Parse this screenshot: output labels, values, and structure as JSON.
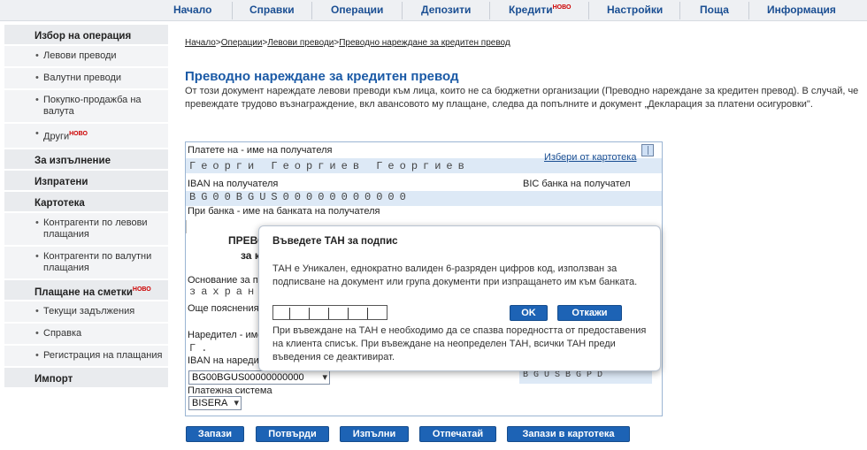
{
  "topnav": {
    "items": [
      "Начало",
      "Справки",
      "Операции",
      "Депозити",
      "Кредити",
      "Настройки",
      "Поща",
      "Информация"
    ],
    "new_badge": "НОВО"
  },
  "sidebar": {
    "sections": [
      {
        "title": "Избор на операция",
        "items": [
          "Левови преводи",
          "Валутни преводи",
          "Покупко-продажба на валута",
          "Други"
        ]
      },
      {
        "title": "За изпълнение"
      },
      {
        "title": "Изпратени"
      },
      {
        "title": "Картотека",
        "items": [
          "Контрагенти по левови плащания",
          "Контрагенти по валутни плащания"
        ]
      },
      {
        "title": "Плащане на сметки",
        "items": [
          "Текущи задължения",
          "Справка",
          "Регистрация на плащания"
        ]
      },
      {
        "title": "Импорт"
      }
    ],
    "new_badge": "НОВО"
  },
  "breadcrumb": {
    "items": [
      "Начало",
      "Операции",
      "Левови преводи",
      "Преводно нареждане за кредитен превод"
    ],
    "sep": ">"
  },
  "main": {
    "title": "Преводно нареждане за кредитен превод",
    "intro": "От този документ нареждате левови преводи към лица, които не са бюджетни организации (Преводно нареждане за кредитен превод). В случай, че превеждате трудово възнаграждение, вкл авансовото му плащане, следва да попълните и документ „Декларация за платени осигуровки\"."
  },
  "form": {
    "payee_label": "Платете на - име на получателя",
    "payee_value": "Георги Георгиев Георгиев",
    "choose_link": "Избери от картотека",
    "iban_label": "IBAN на получателя",
    "iban_value": "BG00BGUS00000000000",
    "bic_label": "BIC банка на получател",
    "bank_label": "При банка - име на банката на получателя",
    "partial_title_1": "ПРЕВО",
    "partial_title_2": "за к",
    "reason_label": "Основание за пр",
    "reason_value": "захран",
    "more_label": "Още пояснения",
    "orderer_label": "Наредител - име",
    "orderer_value": "Г.",
    "orderer_iban_label": "IBAN на наредит",
    "orderer_iban_select": "BG00BGUS00000000000",
    "orderer_bic_value": "BGUSBGPD",
    "system_label": "Платежна система",
    "system_select": "BISERA"
  },
  "buttons": {
    "save": "Запази",
    "confirm": "Потвърди",
    "execute": "Изпълни",
    "print": "Отпечатай",
    "save_card": "Запази в картотека"
  },
  "modal": {
    "title": "Въведете ТАН за подпис",
    "text1": "ТАН е Уникален, еднократно валиден 6-разряден цифров код, използван за подписване на документ или група документи при изпращането им към банката.",
    "ok": "OK",
    "cancel": "Откажи",
    "text2": "При въвеждане на ТАН е необходимо да се спазва поредността от предоставения на клиента списък. При въвеждане на неопределен ТАН, всички ТАН преди въведения се деактивират."
  }
}
